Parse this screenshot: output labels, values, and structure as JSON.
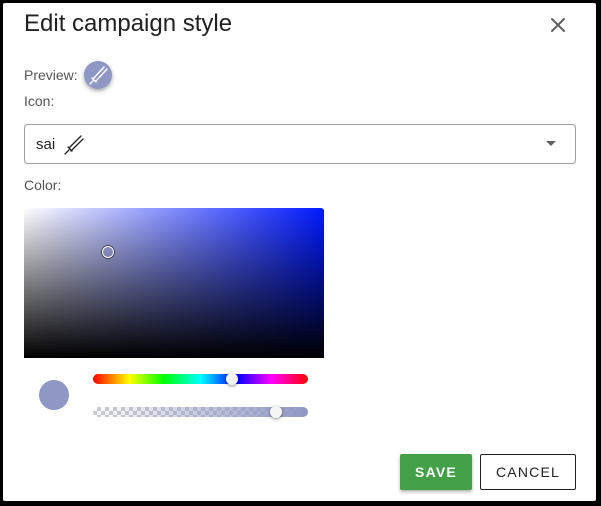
{
  "dialog": {
    "title": "Edit campaign style"
  },
  "preview": {
    "label": "Preview:",
    "icon": "sai-icon",
    "background_color": "#8f97c5"
  },
  "icon_field": {
    "label": "Icon:",
    "value": "sai",
    "glyph": "sai-icon"
  },
  "color_field": {
    "label": "Color:",
    "selected_color": "#8f97c5",
    "hue_color": "#0019ff",
    "hue_level": 0.64,
    "alpha_level": 0.85
  },
  "buttons": {
    "save_label": "SAVE",
    "cancel_label": "CANCEL",
    "save_color": "#43a047"
  }
}
